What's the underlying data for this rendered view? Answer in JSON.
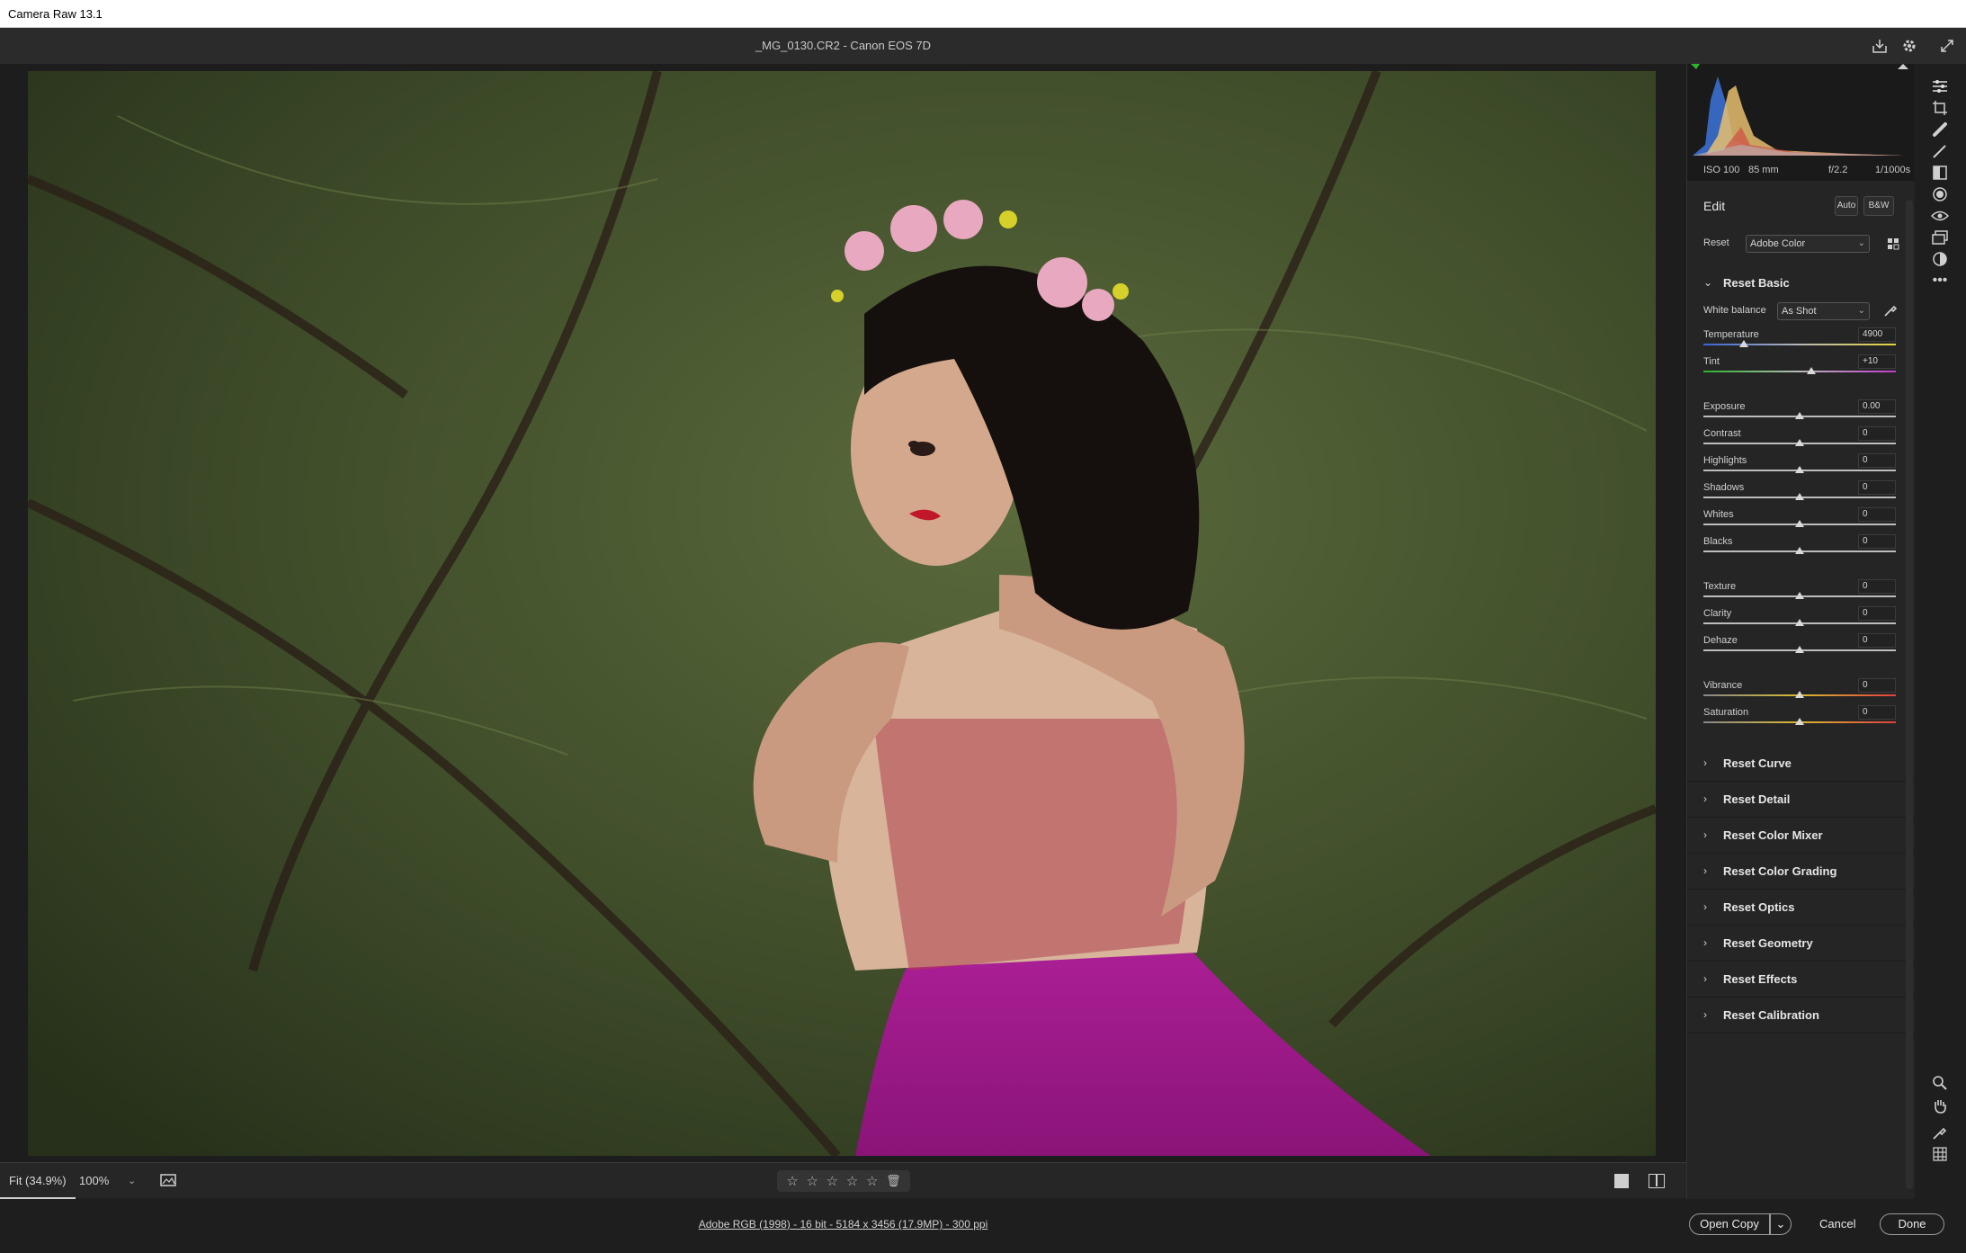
{
  "app": {
    "title": "Camera Raw 13.1"
  },
  "header": {
    "document": "_MG_0130.CR2  -  Canon EOS 7D"
  },
  "exif": {
    "iso": "ISO 100",
    "focal": "85 mm",
    "aperture": "f/2.2",
    "shutter": "1/1000s"
  },
  "edit": {
    "title": "Edit",
    "auto": "Auto",
    "bw": "B&W",
    "reset": "Reset",
    "profile": "Adobe Color"
  },
  "basic": {
    "title": "Reset Basic",
    "white_balance_label": "White balance",
    "white_balance_value": "As Shot",
    "sliders": [
      {
        "name": "Temperature",
        "value": "4900",
        "pos": 0.21
      },
      {
        "name": "Tint",
        "value": "+10",
        "pos": 0.56
      },
      {
        "name": "Exposure",
        "value": "0.00",
        "pos": 0.5
      },
      {
        "name": "Contrast",
        "value": "0",
        "pos": 0.5
      },
      {
        "name": "Highlights",
        "value": "0",
        "pos": 0.5
      },
      {
        "name": "Shadows",
        "value": "0",
        "pos": 0.5
      },
      {
        "name": "Whites",
        "value": "0",
        "pos": 0.5
      },
      {
        "name": "Blacks",
        "value": "0",
        "pos": 0.5
      },
      {
        "name": "Texture",
        "value": "0",
        "pos": 0.5
      },
      {
        "name": "Clarity",
        "value": "0",
        "pos": 0.5
      },
      {
        "name": "Dehaze",
        "value": "0",
        "pos": 0.5
      },
      {
        "name": "Vibrance",
        "value": "0",
        "pos": 0.5
      },
      {
        "name": "Saturation",
        "value": "0",
        "pos": 0.5
      }
    ]
  },
  "sections": [
    "Reset Curve",
    "Reset Detail",
    "Reset Color Mixer",
    "Reset Color Grading",
    "Reset Optics",
    "Reset Geometry",
    "Reset Effects",
    "Reset Calibration"
  ],
  "bottom": {
    "fit": "Fit (34.9%)",
    "zoom": "100%"
  },
  "footer": {
    "info": "Adobe RGB (1998) - 16 bit - 5184 x 3456 (17.9MP) - 300 ppi",
    "open_copy": "Open Copy",
    "cancel": "Cancel",
    "done": "Done"
  },
  "colors": {
    "accent": "#1473e6",
    "panel": "#252525"
  }
}
